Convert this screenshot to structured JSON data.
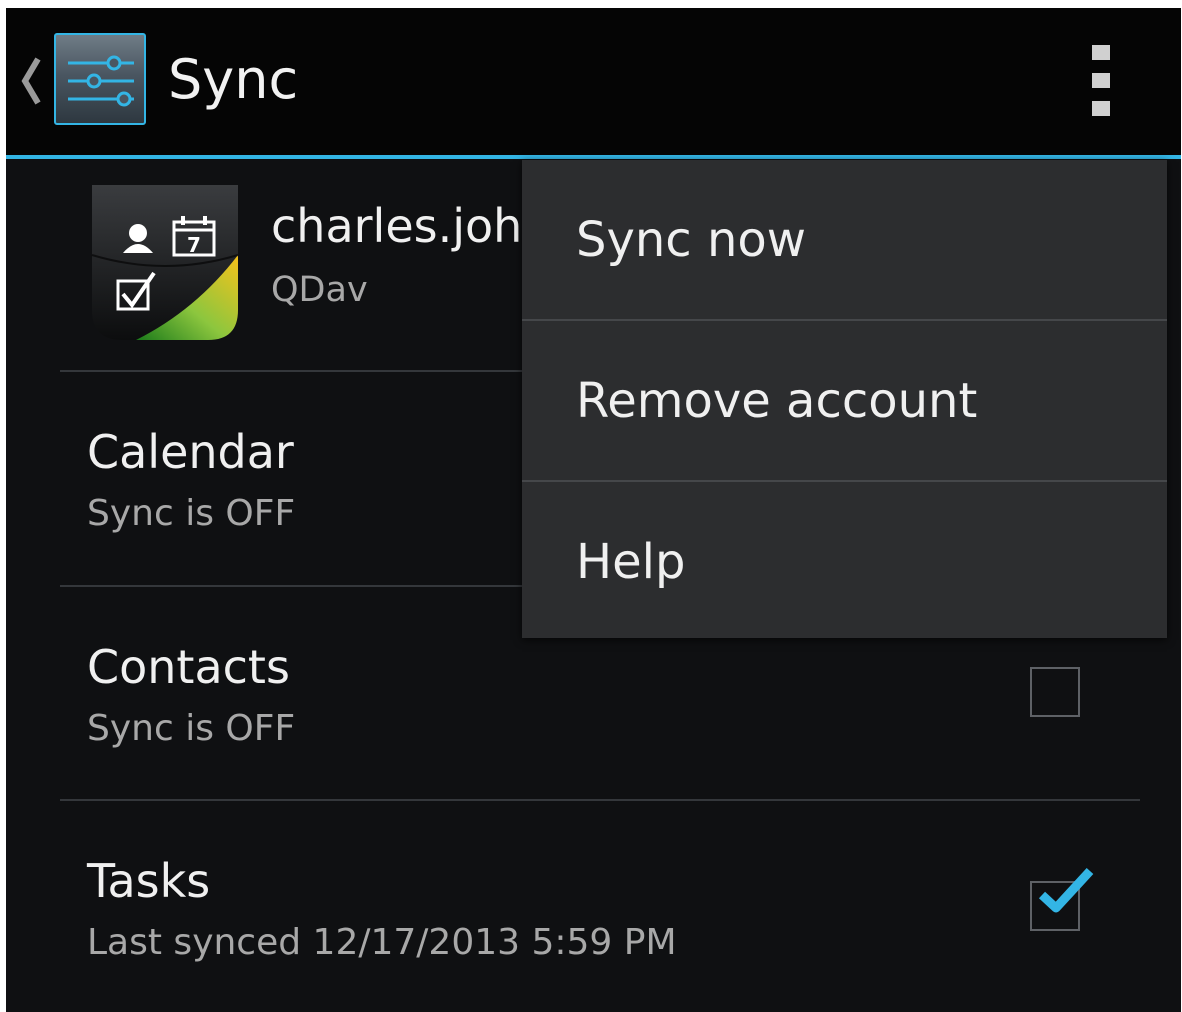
{
  "action_bar": {
    "title": "Sync",
    "up_icon": "chevron-left-icon",
    "app_icon": "settings-sliders-icon",
    "overflow_icon": "overflow-menu-icon",
    "accent_color": "#33b5e5"
  },
  "account": {
    "name": "charles.joh",
    "type": "QDav",
    "icon": "account-sync-icon",
    "calendar_day": "7"
  },
  "sync_items": [
    {
      "title": "Calendar",
      "status": "Sync is OFF",
      "checked": false
    },
    {
      "title": "Contacts",
      "status": "Sync is OFF",
      "checked": false
    },
    {
      "title": "Tasks",
      "status": "Last synced 12/17/2013 5:59 PM",
      "checked": true
    }
  ],
  "menu": {
    "items": [
      {
        "label": "Sync now"
      },
      {
        "label": "Remove account"
      },
      {
        "label": "Help"
      }
    ]
  }
}
